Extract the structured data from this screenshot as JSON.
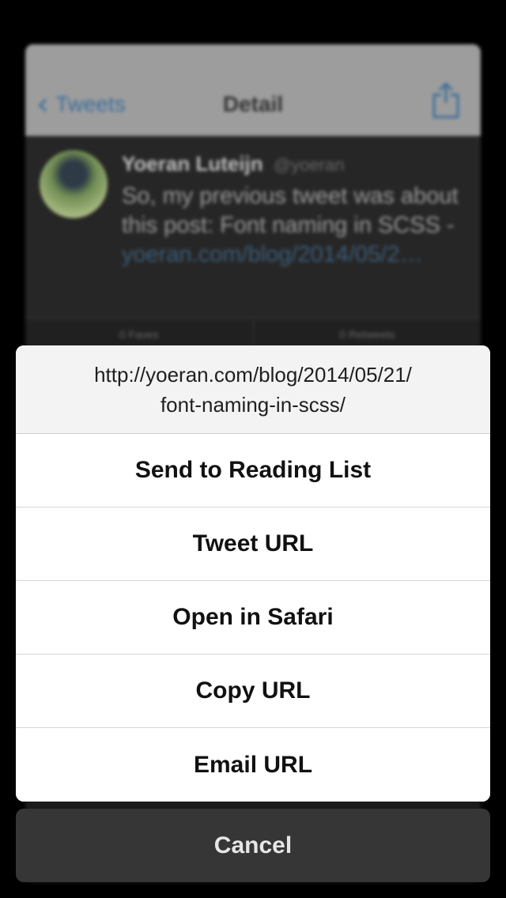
{
  "background": {
    "navbar": {
      "back_label": "Tweets",
      "back_icon": "chevron-left-icon",
      "title": "Detail",
      "share_icon": "share-icon"
    },
    "tweet": {
      "author": "Yoeran Luteijn",
      "handle": "@yoeran",
      "text": "So, my previous tweet was about this post: Font naming in SCSS - ",
      "link": "yoeran.com/blog/2014/05/2…",
      "faves": "0 Faves",
      "retweets": "0 Retweets"
    }
  },
  "action_sheet": {
    "url": "http://yoeran.com/blog/2014/05/21/\nfont-naming-in-scss/",
    "items": [
      {
        "label": "Send to Reading List"
      },
      {
        "label": "Tweet URL"
      },
      {
        "label": "Open in Safari"
      },
      {
        "label": "Copy URL"
      },
      {
        "label": "Email URL"
      }
    ],
    "cancel_label": "Cancel"
  },
  "colors": {
    "accent": "#3d6e9c",
    "sheet_bg": "#ffffff",
    "cancel_bg": "#363636"
  }
}
